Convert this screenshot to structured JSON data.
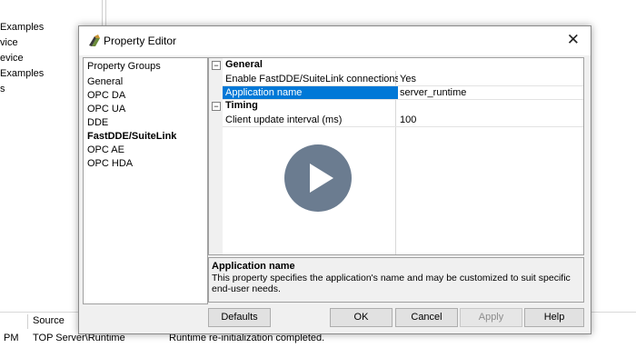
{
  "background": {
    "tree_items": [
      "Examples",
      "vice",
      "evice",
      "Examples",
      "s"
    ],
    "log": {
      "col1_fragment": "PM",
      "header_source": "Source",
      "row_source": "TOP Server\\Runtime",
      "row_message": "Runtime re-initialization completed."
    }
  },
  "dialog": {
    "title": "Property Editor",
    "close_glyph": "✕",
    "groups_header": "Property Groups",
    "groups": [
      "General",
      "OPC DA",
      "OPC UA",
      "DDE",
      "FastDDE/SuiteLink",
      "OPC AE",
      "OPC HDA"
    ],
    "active_group": "FastDDE/SuiteLink",
    "categories": [
      {
        "label": "General",
        "toggle": "−",
        "properties": [
          {
            "name": "Enable FastDDE/SuiteLink connections...",
            "value": "Yes"
          },
          {
            "name": "Application name",
            "value": "server_runtime",
            "selected": true
          }
        ]
      },
      {
        "label": "Timing",
        "toggle": "−",
        "properties": [
          {
            "name": "Client update interval (ms)",
            "value": "100"
          }
        ]
      }
    ],
    "description": {
      "title": "Application name",
      "body": "This property specifies the application's name and may be customized to suit specific end-user needs."
    },
    "buttons": {
      "defaults": "Defaults",
      "ok": "OK",
      "cancel": "Cancel",
      "apply": "Apply",
      "help": "Help"
    }
  },
  "overlay": {
    "icon": "play-icon",
    "color": "#4b5f78"
  }
}
